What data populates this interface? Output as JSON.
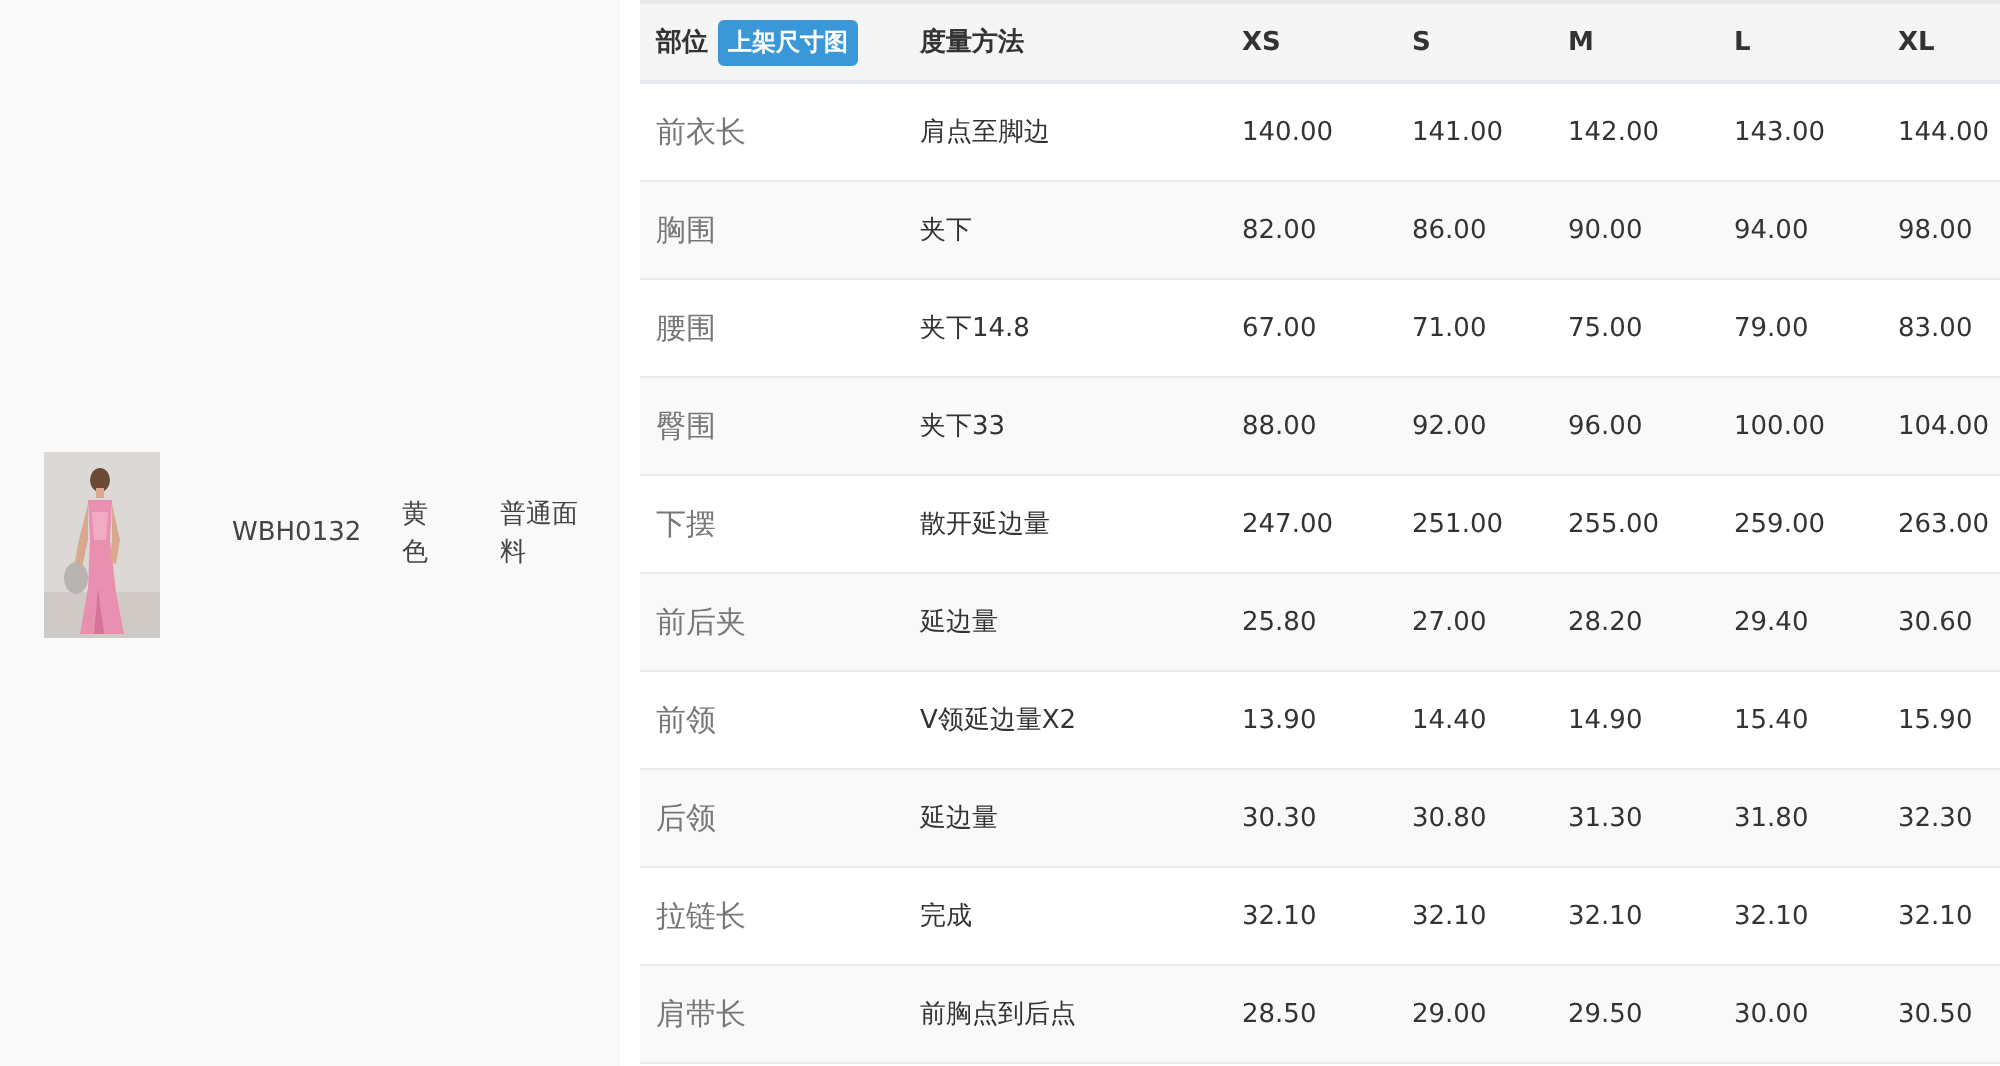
{
  "product": {
    "code": "WBH0132",
    "colour_name": "黄色",
    "material": "普通面料"
  },
  "size_table": {
    "columns": [
      {
        "label": "部位",
        "button": "上架尺寸图"
      },
      {
        "label": "度量方法"
      },
      {
        "label": "XS"
      },
      {
        "label": "S"
      },
      {
        "label": "M"
      },
      {
        "label": "L"
      },
      {
        "label": "XL"
      }
    ],
    "rows": [
      {
        "part": "前衣长",
        "method": "肩点至脚边",
        "values": [
          "140.00",
          "141.00",
          "142.00",
          "143.00",
          "144.00"
        ]
      },
      {
        "part": "胸围",
        "method": "夹下",
        "values": [
          "82.00",
          "86.00",
          "90.00",
          "94.00",
          "98.00"
        ]
      },
      {
        "part": "腰围",
        "method": "夹下14.8",
        "values": [
          "67.00",
          "71.00",
          "75.00",
          "79.00",
          "83.00"
        ]
      },
      {
        "part": "臀围",
        "method": "夹下33",
        "values": [
          "88.00",
          "92.00",
          "96.00",
          "100.00",
          "104.00"
        ]
      },
      {
        "part": "下摆",
        "method": "散开延边量",
        "values": [
          "247.00",
          "251.00",
          "255.00",
          "259.00",
          "263.00"
        ]
      },
      {
        "part": "前后夹",
        "method": "延边量",
        "values": [
          "25.80",
          "27.00",
          "28.20",
          "29.40",
          "30.60"
        ]
      },
      {
        "part": "前领",
        "method": "V领延边量X2",
        "values": [
          "13.90",
          "14.40",
          "14.90",
          "15.40",
          "15.90"
        ]
      },
      {
        "part": "后领",
        "method": "延边量",
        "values": [
          "30.30",
          "30.80",
          "31.30",
          "31.80",
          "32.30"
        ]
      },
      {
        "part": "拉链长",
        "method": "完成",
        "values": [
          "32.10",
          "32.10",
          "32.10",
          "32.10",
          "32.10"
        ]
      },
      {
        "part": "肩带长",
        "method": "前胸点到后点",
        "values": [
          "28.50",
          "29.00",
          "29.50",
          "30.00",
          "30.50"
        ]
      }
    ]
  }
}
